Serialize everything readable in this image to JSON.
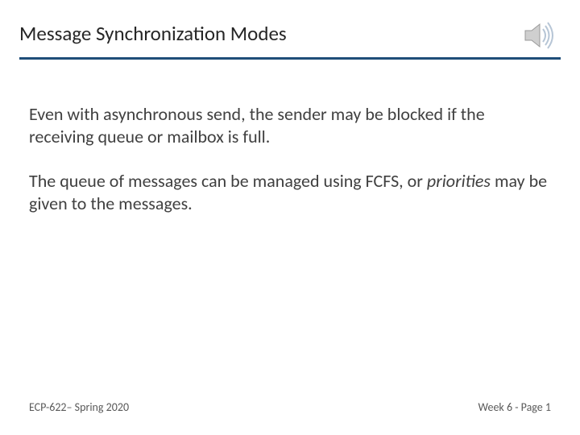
{
  "header": {
    "title": "Message Synchronization Modes"
  },
  "icons": {
    "audio": "audio-speaker-icon"
  },
  "body": {
    "p1": "Even with asynchronous send, the sender may be blocked if the receiving queue or mailbox is full.",
    "p2_a": "The queue of messages can be managed using FCFS, or ",
    "p2_em": "priorities",
    "p2_b": " may be given to the messages."
  },
  "footer": {
    "left": "ECP-622– Spring 2020",
    "right": "Week 6 - Page 1"
  }
}
